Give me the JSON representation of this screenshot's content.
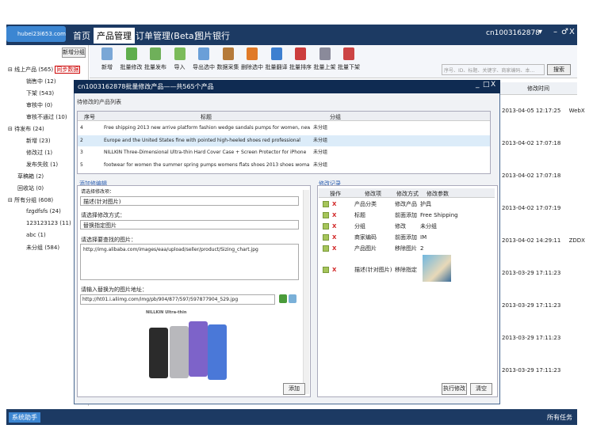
{
  "header": {
    "account": "hubei23i653.com",
    "tabs": [
      "首页",
      "产品管理",
      "订单管理(Beta)",
      "图片银行"
    ],
    "user": "cn1003162878",
    "user_arrow": "▾",
    "min": "–",
    "restore": "♂",
    "close": "X"
  },
  "sidebar": {
    "category_button": "新增分组",
    "items": [
      {
        "label": "⊟ 线上产品 (565)",
        "badge": "同步数据"
      },
      {
        "label": "销售中 (12)"
      },
      {
        "label": "下架 (543)"
      },
      {
        "label": "审核中 (0)"
      },
      {
        "label": "审核不通过 (10)"
      },
      {
        "label": "⊟ 待发布 (24)"
      },
      {
        "label": "新增 (23)"
      },
      {
        "label": "修改过 (1)"
      },
      {
        "label": "发布失败 (1)"
      },
      {
        "label": "草稿箱 (2)"
      },
      {
        "label": "回收站 (0)"
      },
      {
        "label": "⊟ 所有分组 (608)"
      },
      {
        "label": "fzgdfsfs (24)"
      },
      {
        "label": "123123123 (11)"
      },
      {
        "label": "abc (1)"
      },
      {
        "label": "未分组 (584)"
      }
    ]
  },
  "toolbar": {
    "buttons": [
      {
        "label": "新增",
        "color": "#7aa7d6"
      },
      {
        "label": "批量修改",
        "color": "#5fae4d"
      },
      {
        "label": "批量发布",
        "color": "#6fb05a"
      },
      {
        "label": "导入",
        "color": "#7bbb5a"
      },
      {
        "label": "导出选中",
        "color": "#6a9fd8"
      },
      {
        "label": "数据采集",
        "color": "#b57a3a"
      },
      {
        "label": "删除选中",
        "color": "#e07a28"
      },
      {
        "label": "批量翻译",
        "color": "#3d7fd0"
      },
      {
        "label": "批量排序",
        "color": "#cc3d3d"
      },
      {
        "label": "批量上架",
        "color": "#8a8a9a"
      },
      {
        "label": "批量下架",
        "color": "#cc4444"
      }
    ],
    "search_placeholder": "序号、ID、标题、关键字、商家编码、本…",
    "search_button": "搜索"
  },
  "right": {
    "header": "修改时间",
    "dates": [
      {
        "d": "2013-04-05 12:17:25",
        "x": "WebX"
      },
      {
        "d": "2013-04-02 17:07:18",
        "x": ""
      },
      {
        "d": "2013-04-02 17:07:18",
        "x": ""
      },
      {
        "d": "2013-04-02 17:07:19",
        "x": ""
      },
      {
        "d": "2013-04-02 14:29:11",
        "x": "ZDDX"
      },
      {
        "d": "2013-03-29 17:11:23",
        "x": ""
      },
      {
        "d": "2013-03-29 17:11:23",
        "x": ""
      },
      {
        "d": "2013-03-29 17:11:23",
        "x": ""
      },
      {
        "d": "2013-03-29 17:11:23",
        "x": ""
      }
    ]
  },
  "dialog": {
    "title": "cn1003162878批量修改产品——共565个产品",
    "section_products": "待修改的产品列表",
    "cols": {
      "no": "序号",
      "title": "标题",
      "group": "分组"
    },
    "rows": [
      {
        "no": "4",
        "title": "Free shipping 2013 new arrive platform fashion wedge sandals pumps for women, new",
        "group": "未分组"
      },
      {
        "no": "2",
        "title": "Europe and the United States fine with pointed high-heeled shoes red professional",
        "group": "未分组"
      },
      {
        "no": "3",
        "title": "NILLKIN Three-Dimensional Ultra-thin Hard Cover Case + Screen Protector for iPhone",
        "group": "未分组"
      },
      {
        "no": "5",
        "title": "footwear for women the summer spring pumps womens flats shoes 2013  shoes woman n",
        "group": "未分组"
      }
    ],
    "section_edit": "添加修编辑",
    "field_select_hint": "请选择修改项：",
    "field_select_value": "描述(针对图片)",
    "field_mode_label": "请选择修改方式：",
    "field_mode_value": "替换指定图片",
    "field_find_label": "请选择要查找的图片：",
    "field_find_value": "http://img.alibaba.com/images/eaa/upload/seller/product/Sizing_chart.jpg",
    "field_replace_label": "请输入替换为的图片地址：",
    "field_replace_value": "http://ht01.i.aliimg.com/img/pb/904/877/597/597877904_529.jpg",
    "brand_text": "NILLKIN  Ultra-thin",
    "add_button": "添加",
    "section_log": "修改记录",
    "log_cols": {
      "op": "操作",
      "item": "修改项",
      "mode": "修改方式",
      "param": "修改参数"
    },
    "log_rows": [
      {
        "item": "产品分类",
        "mode": "修改产品",
        "param": "护具"
      },
      {
        "item": "标题",
        "mode": "前面添加",
        "param": "Free Shipping"
      },
      {
        "item": "分组",
        "mode": "修改",
        "param": "未分组"
      },
      {
        "item": "商家编码",
        "mode": "前面添加",
        "param": "IM"
      },
      {
        "item": "产品图片",
        "mode": "移除图片",
        "param": "2"
      },
      {
        "item": "描述(针对图片)",
        "mode": "移除指定",
        "param": ""
      }
    ],
    "exec_button": "执行修改",
    "clear_button": "清空",
    "minimize": "_",
    "maximize": "□",
    "close": "X"
  },
  "footer": {
    "left": "系统助手",
    "right": "所有任务"
  }
}
